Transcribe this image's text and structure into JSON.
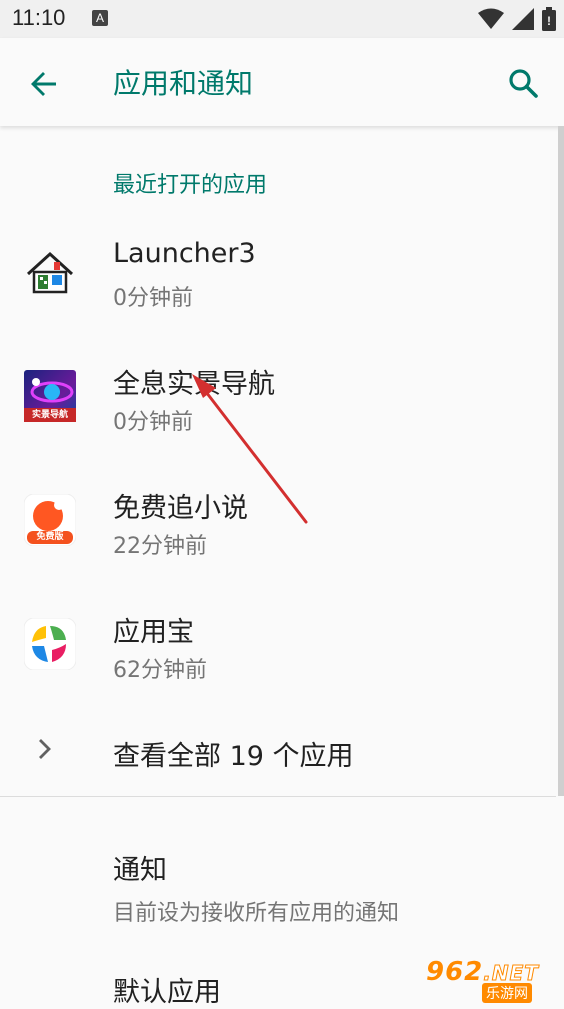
{
  "status_bar": {
    "time": "11:10",
    "notification_icon_label": "A",
    "icons": [
      "wifi-icon",
      "signal-icon",
      "battery-icon"
    ]
  },
  "app_bar": {
    "title": "应用和通知",
    "back_icon": "arrow-back-icon",
    "search_icon": "search-icon"
  },
  "recent": {
    "header": "最近打开的应用",
    "apps": [
      {
        "name": "Launcher3",
        "time": "0分钟前",
        "icon": "launcher-house-icon"
      },
      {
        "name": "全息实景导航",
        "time": "0分钟前",
        "icon": "navigation-app-icon",
        "icon_text": "实景导航"
      },
      {
        "name": "免费追小说",
        "time": "22分钟前",
        "icon": "novel-app-icon",
        "icon_text": "免费版"
      },
      {
        "name": "应用宝",
        "time": "62分钟前",
        "icon": "app-store-icon"
      }
    ],
    "see_all": "查看全部 19 个应用"
  },
  "preferences": [
    {
      "title": "通知",
      "summary": "目前设为接收所有应用的通知"
    },
    {
      "title": "默认应用",
      "summary": ""
    }
  ],
  "watermark": {
    "logo": "962",
    "suffix": ".NET",
    "subtitle": "乐游网"
  },
  "colors": {
    "accent": "#00796b",
    "background": "#fafafa",
    "secondary_text": "#757575",
    "annotation_arrow": "#d32f2f"
  }
}
